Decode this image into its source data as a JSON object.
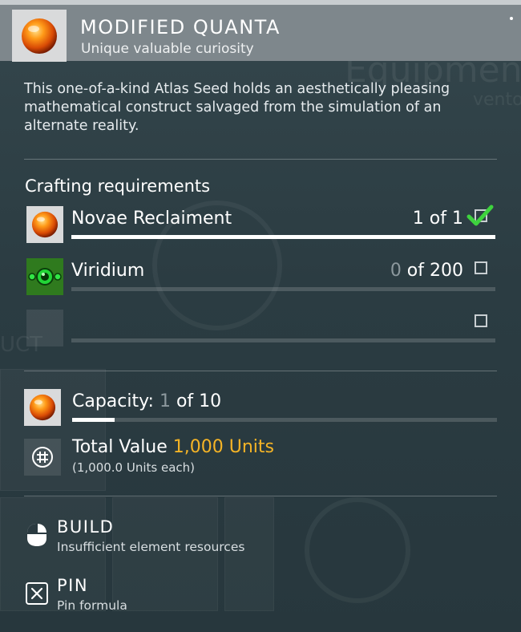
{
  "item": {
    "title": "MODIFIED QUANTA",
    "subtitle": "Unique valuable curiosity",
    "icon": "orange-orb-icon",
    "description": "This one-of-a-kind Atlas Seed holds an aesthetically pleasing mathematical construct salvaged from the simulation of an alternate reality."
  },
  "crafting": {
    "title": "Crafting requirements",
    "requirements": [
      {
        "name": "Novae Reclaiment",
        "have": "1",
        "of_text": " of 1",
        "icon": "orange-orb-icon",
        "met": true,
        "progress": 1.0
      },
      {
        "name": "Viridium",
        "have": "0",
        "of_text": " of 200",
        "icon": "green-viridium-icon",
        "met": false,
        "progress": 0.0
      },
      {
        "name": "",
        "have": "",
        "of_text": "",
        "icon": "empty-slot-icon",
        "met": false,
        "progress": 0.0
      }
    ]
  },
  "capacity": {
    "label": "Capacity:",
    "have": " 1",
    "of_text": " of 10",
    "fraction": 0.1
  },
  "total_value": {
    "label": "Total Value ",
    "amount": "1,000 Units",
    "each": "(1,000.0 Units each)"
  },
  "actions": {
    "build": {
      "label": "BUILD",
      "sub": "Insufficient element resources"
    },
    "pin": {
      "label": "PIN",
      "sub": "Pin formula"
    }
  },
  "colors": {
    "accent": "#f5b426",
    "check": "#3ed33e",
    "header_bg": "#7e878c",
    "panel_bg": "#2a3a40"
  }
}
